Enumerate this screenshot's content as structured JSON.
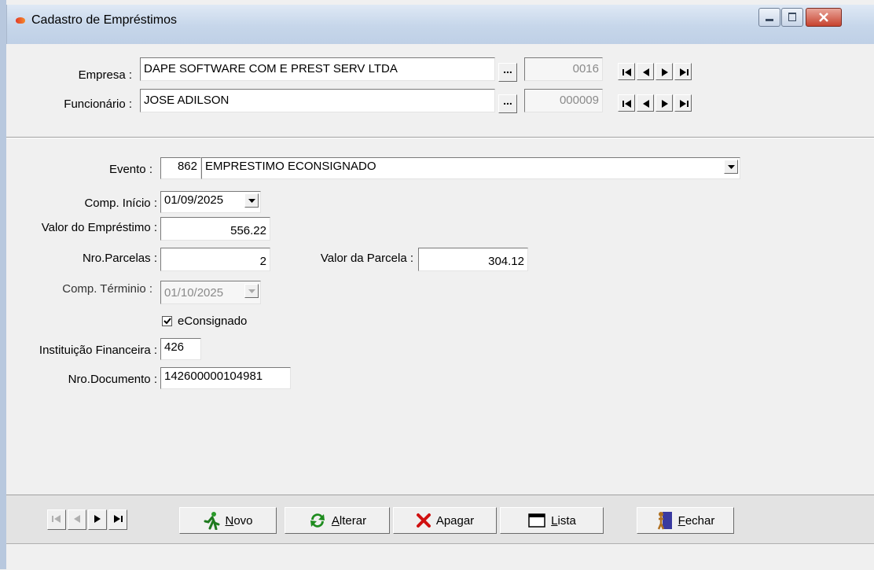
{
  "window": {
    "title": "Cadastro de Empréstimos"
  },
  "empresa": {
    "label": "Empresa :",
    "value": "DAPE SOFTWARE COM E PREST SERV LTDA",
    "lookup_label": "...",
    "code": "0016"
  },
  "funcionario": {
    "label": "Funcionário :",
    "value": "JOSE ADILSON",
    "lookup_label": "...",
    "code": "000009"
  },
  "evento": {
    "label": "Evento :",
    "code": "862",
    "value": "EMPRESTIMO ECONSIGNADO"
  },
  "comp_inicio": {
    "label": "Comp. Início :",
    "value": "01/09/2025"
  },
  "valor_emprestimo": {
    "label": "Valor do Empréstimo :",
    "value": "556.22"
  },
  "nro_parcelas": {
    "label": "Nro.Parcelas :",
    "value": "2"
  },
  "valor_parcela": {
    "label": "Valor da Parcela :",
    "value": "304.12"
  },
  "comp_termino": {
    "label": "Comp. Términio :",
    "value": "01/10/2025"
  },
  "econsignado": {
    "label": "eConsignado",
    "checked": true
  },
  "instituicao": {
    "label": "Instituição Financeira :",
    "value": "426"
  },
  "nro_documento": {
    "label": "Nro.Documento :",
    "value": "142600000104981"
  },
  "toolbar": {
    "novo": {
      "pre": "",
      "u": "N",
      "post": "ovo"
    },
    "alterar": {
      "pre": "",
      "u": "A",
      "post": "lterar"
    },
    "apagar": {
      "label": "Apagar"
    },
    "lista": {
      "pre": "",
      "u": "L",
      "post": "ista"
    },
    "fechar": {
      "pre": "",
      "u": "F",
      "post": "echar"
    }
  },
  "colors": {
    "accent_title": "#c6d6ea",
    "close": "#c7432f"
  },
  "icons": [
    "app-icon",
    "minimize-icon",
    "maximize-icon",
    "close-icon",
    "first-icon",
    "prev-icon",
    "next-icon",
    "last-icon",
    "dropdown-arrow-icon",
    "runner-icon",
    "refresh-icon",
    "delete-x-icon",
    "list-window-icon",
    "exit-door-icon"
  ]
}
